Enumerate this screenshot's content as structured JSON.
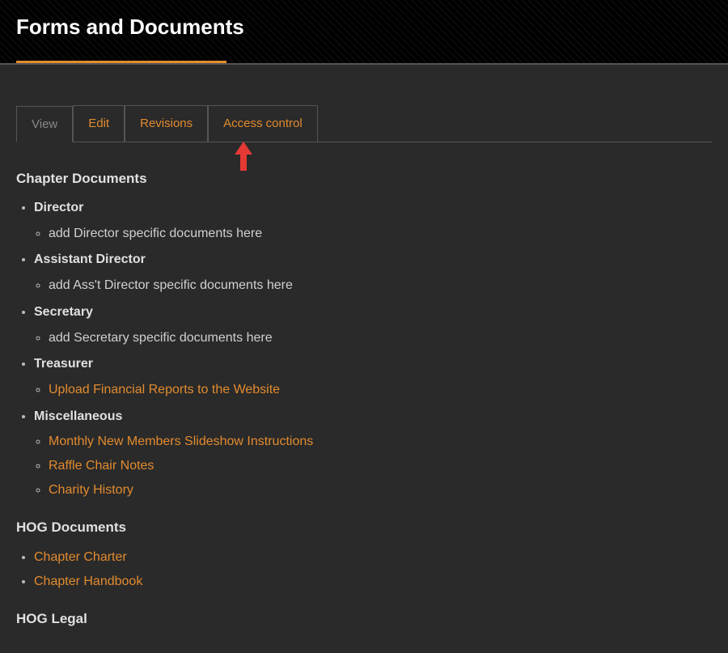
{
  "header": {
    "title": "Forms and Documents"
  },
  "tabs": [
    {
      "label": "View",
      "active": true
    },
    {
      "label": "Edit",
      "active": false
    },
    {
      "label": "Revisions",
      "active": false
    },
    {
      "label": "Access control",
      "active": false
    }
  ],
  "sections": {
    "chapter_documents": {
      "heading": "Chapter Documents",
      "groups": [
        {
          "title": "Director",
          "items": [
            {
              "label": "add Director specific documents here",
              "link": false
            }
          ]
        },
        {
          "title": "Assistant Director",
          "items": [
            {
              "label": "add Ass't Director specific documents here",
              "link": false
            }
          ]
        },
        {
          "title": "Secretary",
          "items": [
            {
              "label": "add Secretary specific documents here",
              "link": false
            }
          ]
        },
        {
          "title": "Treasurer",
          "items": [
            {
              "label": "Upload Financial Reports to the Website",
              "link": true
            }
          ]
        },
        {
          "title": "Miscellaneous",
          "items": [
            {
              "label": "Monthly New Members Slideshow Instructions",
              "link": true
            },
            {
              "label": "Raffle Chair Notes",
              "link": true
            },
            {
              "label": "Charity History",
              "link": true
            }
          ]
        }
      ]
    },
    "hog_documents": {
      "heading": "HOG Documents",
      "items": [
        {
          "label": "Chapter Charter",
          "link": true
        },
        {
          "label": "Chapter Handbook",
          "link": true
        }
      ]
    },
    "hog_legal": {
      "heading": "HOG Legal"
    }
  },
  "colors": {
    "accent": "#e28b2f",
    "bg": "#2a2a2a",
    "arrow": "#e53935"
  }
}
